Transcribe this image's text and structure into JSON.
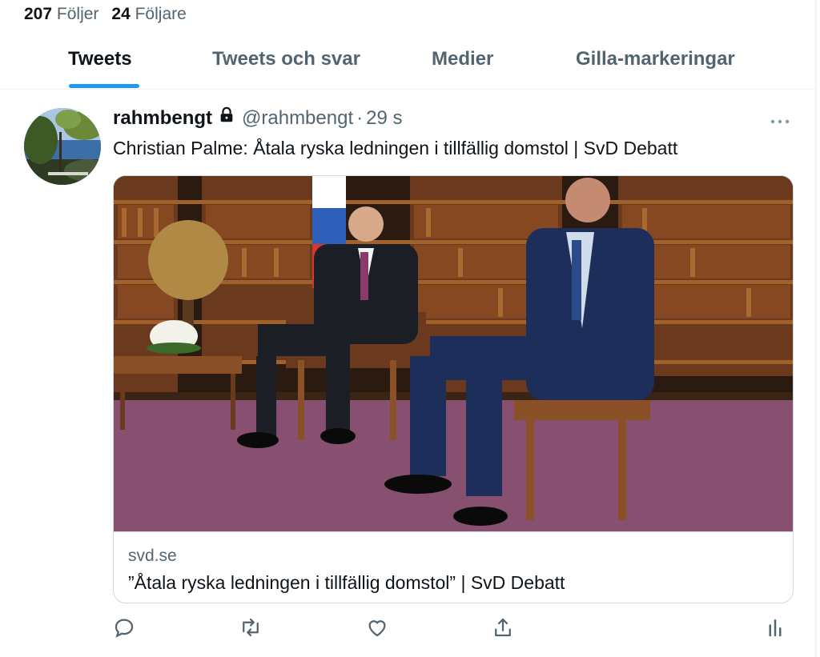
{
  "profile_stats": {
    "following_count": "207",
    "following_label": "Följer",
    "followers_count": "24",
    "followers_label": "Följare"
  },
  "tabs": [
    {
      "label": "Tweets",
      "active": true
    },
    {
      "label": "Tweets och svar",
      "active": false
    },
    {
      "label": "Medier",
      "active": false
    },
    {
      "label": "Gilla-markeringar",
      "active": false
    }
  ],
  "tweet": {
    "author_name": "rahmbengt",
    "author_handle": "@rahmbengt",
    "separator": "·",
    "timestamp": "29 s",
    "protected_icon": "lock-icon",
    "text": "Christian Palme: Åtala ryska ledningen i tillfällig domstol | SvD Debatt",
    "card": {
      "domain": "svd.se",
      "title": "”Åtala ryska ledningen i tillfällig domstol” | SvD Debatt"
    },
    "actions": [
      "reply-icon",
      "retweet-icon",
      "like-icon",
      "share-icon",
      "analytics-icon"
    ]
  },
  "colors": {
    "accent": "#1d9bf0",
    "text_primary": "#0f1419",
    "text_secondary": "#536471",
    "border": "#cfd9de"
  }
}
